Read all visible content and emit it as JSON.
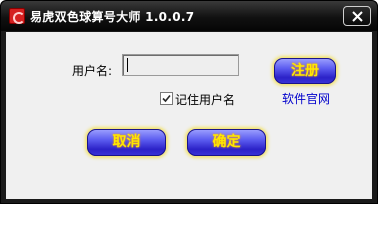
{
  "window": {
    "title": "易虎双色球算号大师  1.0.0.7"
  },
  "login": {
    "username_label": "用户名:",
    "username_value": "",
    "remember_label": "记住用户名",
    "remember_checked": true
  },
  "buttons": {
    "register": "注册",
    "official_site": "软件官网",
    "cancel": "取消",
    "ok": "确定"
  },
  "colors": {
    "title_bar": "#111111",
    "client_bg": "#f0f0f0",
    "button_blue": "#3b36d8",
    "button_text": "#ffe800",
    "link": "#0000cc"
  },
  "icons": {
    "app": "app-logo-icon",
    "close": "close-icon",
    "check": "checkmark-icon"
  }
}
